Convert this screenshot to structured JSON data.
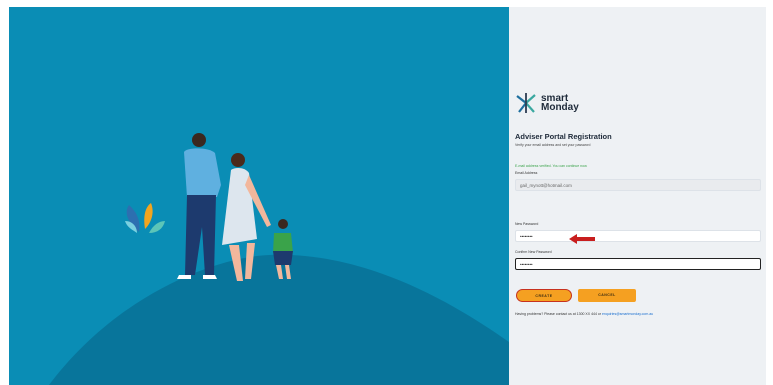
{
  "brand": {
    "line1": "smart",
    "line2": "Monday"
  },
  "form": {
    "title": "Adviser Portal Registration",
    "subtitle": "Verify your email address and set your password",
    "success_message": "E-mail address verified. You can continue now.",
    "email_label": "Email Address",
    "email_value": "gail_mynott@hotmail.com",
    "new_password_label": "New Password",
    "new_password_value": "••••••••",
    "confirm_password_label": "Confirm New Password",
    "confirm_password_value": "••••••••",
    "create_label": "CREATE",
    "cancel_label": "CANCEL",
    "help_text": "Having problems? Please contact us at 1300 XX 444 or",
    "help_link": "enquiries@smartmonday.com.au"
  },
  "colors": {
    "hero_bg": "#0a8db5",
    "hill": "#08759b",
    "button": "#f5a021",
    "highlight": "#c7321e",
    "success": "#3aa34a",
    "link": "#1a6fcf"
  },
  "icons": [
    "smartmonday-logo-icon",
    "arrow-left-icon"
  ]
}
